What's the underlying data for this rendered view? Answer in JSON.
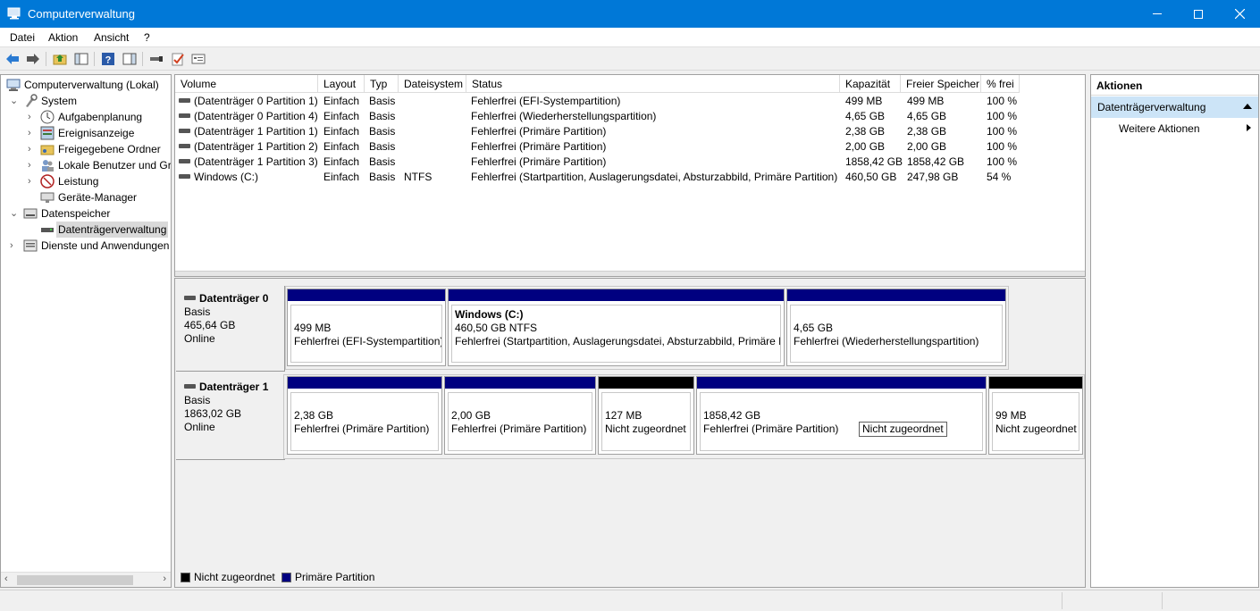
{
  "window": {
    "title": "Computerverwaltung",
    "title_bar_color": "#0078d7",
    "controls": [
      "minimize-icon",
      "maximize-icon",
      "close-icon"
    ]
  },
  "menu": {
    "datei": "Datei",
    "aktion": "Aktion",
    "ansicht": "Ansicht",
    "help": "?"
  },
  "toolbar": {
    "icons": [
      "back-arrow-icon",
      "forward-arrow-icon",
      "up-folder-icon",
      "show-hide-tree-icon",
      "help-icon",
      "show-hide-action-pane-icon",
      "connect-icon",
      "properties-check-icon",
      "console-list-icon"
    ]
  },
  "tree": {
    "root": "Computerverwaltung (Lokal)",
    "system": "System",
    "aufgabenplanung": "Aufgabenplanung",
    "ereignisanzeige": "Ereignisanzeige",
    "freigegebene_ordner": "Freigegebene Ordner",
    "lokale_benutzer": "Lokale Benutzer und Gr",
    "leistung": "Leistung",
    "geraete_manager": "Geräte-Manager",
    "datenspeicher": "Datenspeicher",
    "datentraegerverwaltung": "Datenträgerverwaltung",
    "dienste": "Dienste und Anwendungen"
  },
  "volumes": {
    "columns": {
      "volume": "Volume",
      "layout": "Layout",
      "typ": "Typ",
      "dateisystem": "Dateisystem",
      "status": "Status",
      "kapazitaet": "Kapazität",
      "freier_speicher": "Freier Speicher",
      "prozent_frei": "% frei"
    },
    "rows": [
      {
        "volume": "(Datenträger 0 Partition 1)",
        "layout": "Einfach",
        "typ": "Basis",
        "fs": "",
        "status": "Fehlerfrei (EFI-Systempartition)",
        "kap": "499 MB",
        "frei": "499 MB",
        "pct": "100 %"
      },
      {
        "volume": "(Datenträger 0 Partition 4)",
        "layout": "Einfach",
        "typ": "Basis",
        "fs": "",
        "status": "Fehlerfrei (Wiederherstellungspartition)",
        "kap": "4,65 GB",
        "frei": "4,65 GB",
        "pct": "100 %"
      },
      {
        "volume": "(Datenträger 1 Partition 1)",
        "layout": "Einfach",
        "typ": "Basis",
        "fs": "",
        "status": "Fehlerfrei (Primäre Partition)",
        "kap": "2,38 GB",
        "frei": "2,38 GB",
        "pct": "100 %"
      },
      {
        "volume": "(Datenträger 1 Partition 2)",
        "layout": "Einfach",
        "typ": "Basis",
        "fs": "",
        "status": "Fehlerfrei (Primäre Partition)",
        "kap": "2,00 GB",
        "frei": "2,00 GB",
        "pct": "100 %"
      },
      {
        "volume": "(Datenträger 1 Partition 3)",
        "layout": "Einfach",
        "typ": "Basis",
        "fs": "",
        "status": "Fehlerfrei (Primäre Partition)",
        "kap": "1858,42 GB",
        "frei": "1858,42 GB",
        "pct": "100 %"
      },
      {
        "volume": "Windows (C:)",
        "layout": "Einfach",
        "typ": "Basis",
        "fs": "NTFS",
        "status": "Fehlerfrei (Startpartition, Auslagerungsdatei, Absturzabbild, Primäre Partition)",
        "kap": "460,50 GB",
        "frei": "247,98 GB",
        "pct": "54 %"
      }
    ]
  },
  "disks": {
    "disk0": {
      "name": "Datenträger 0",
      "type": "Basis",
      "size": "465,64 GB",
      "state": "Online",
      "partitions": [
        {
          "title": "",
          "size": "499 MB",
          "status": "Fehlerfrei (EFI-Systempartition)"
        },
        {
          "title": "Windows  (C:)",
          "size": "460,50 GB NTFS",
          "status": "Fehlerfrei (Startpartition, Auslagerungsdatei, Absturzabbild, Primäre P"
        },
        {
          "title": "",
          "size": "4,65 GB",
          "status": "Fehlerfrei (Wiederherstellungspartition)"
        }
      ]
    },
    "disk1": {
      "name": "Datenträger 1",
      "type": "Basis",
      "size": "1863,02 GB",
      "state": "Online",
      "partitions": [
        {
          "size": "2,38 GB",
          "status": "Fehlerfrei (Primäre Partition)"
        },
        {
          "size": "2,00 GB",
          "status": "Fehlerfrei (Primäre Partition)"
        },
        {
          "size": "127 MB",
          "status": "Nicht zugeordnet"
        },
        {
          "size": "1858,42 GB",
          "status": "Fehlerfrei (Primäre Partition)"
        },
        {
          "size": "99 MB",
          "status": "Nicht zugeordnet"
        }
      ],
      "tooltip": "Nicht zugeordnet"
    }
  },
  "legend": {
    "unallocated": "Nicht zugeordnet",
    "primary": "Primäre Partition",
    "unallocated_color": "#000000",
    "primary_color": "#000080"
  },
  "actions": {
    "header": "Aktionen",
    "section": "Datenträgerverwaltung",
    "more": "Weitere Aktionen",
    "selected_color": "#cce4f7"
  }
}
